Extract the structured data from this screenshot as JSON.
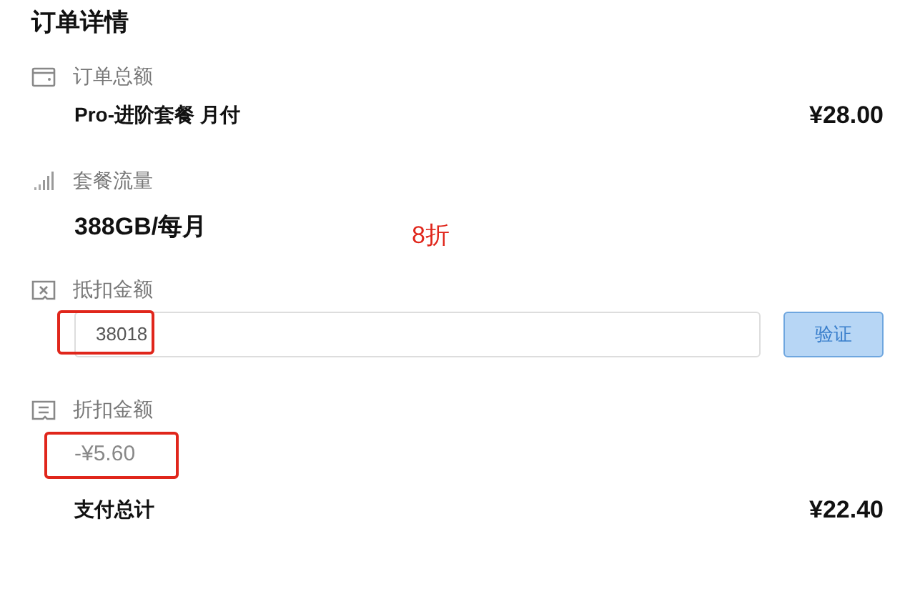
{
  "title": "订单详情",
  "sections": [
    {
      "kind": "plan",
      "label": "订单总额",
      "value": "Pro-进阶套餐 月付",
      "amount": "¥28.00"
    },
    {
      "kind": "traffic",
      "label": "套餐流量",
      "value": "388GB/每月",
      "note": "8折"
    },
    {
      "kind": "code",
      "label": "抵扣金额",
      "value": "38018",
      "button": "验证",
      "highlighted": true
    },
    {
      "kind": "discount",
      "label": "折扣金额",
      "value": "-¥5.60",
      "highlighted": true
    }
  ],
  "total": {
    "label": "支付总计",
    "amount": "¥22.40"
  }
}
